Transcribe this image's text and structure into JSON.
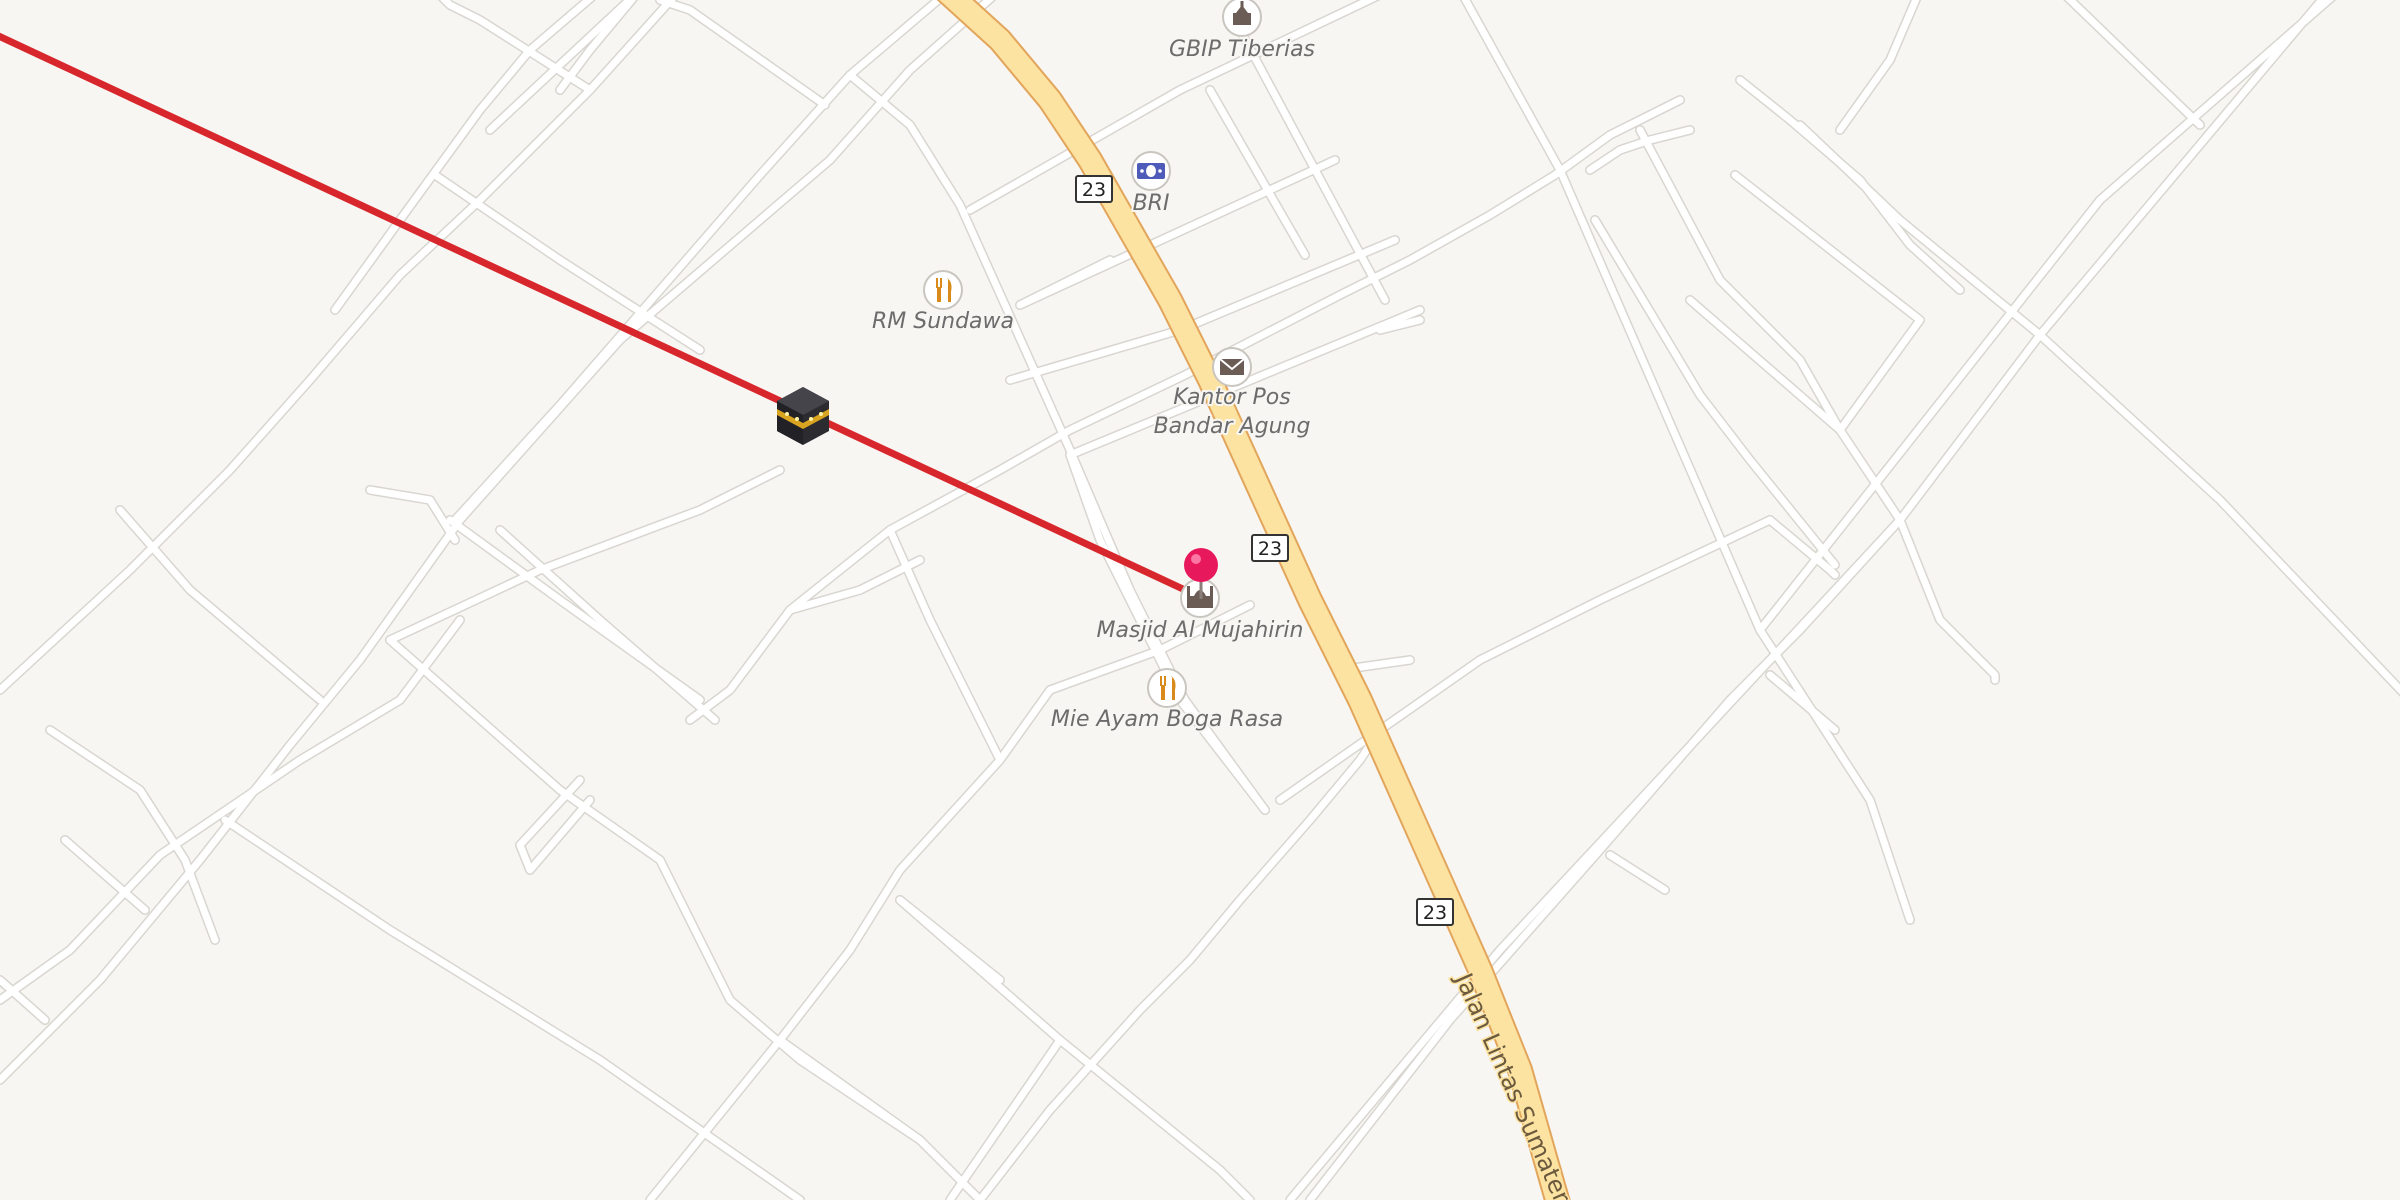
{
  "map": {
    "highway": {
      "route_number": "23",
      "street_name": "Jalan Lintas Sumatera"
    },
    "pois": [
      {
        "name": "GBIP Tiberias",
        "icon": "church-icon"
      },
      {
        "name": "BRI",
        "icon": "bank-icon"
      },
      {
        "name": "RM Sundawa",
        "icon": "restaurant-icon"
      },
      {
        "name": "Kantor Pos",
        "name_line2": "Bandar Agung",
        "icon": "post-office-icon"
      },
      {
        "name": "Masjid Al Mujahirin",
        "icon": "mosque-icon"
      },
      {
        "name": "Mie Ayam Boga Rasa",
        "icon": "restaurant-icon"
      }
    ],
    "markers": {
      "location_pin": {
        "icon": "location-pin-icon",
        "color": "#e8185c"
      },
      "qibla": {
        "icon": "kaaba-icon",
        "line_color": "#d8272c"
      }
    },
    "colors": {
      "background": "#f8f6f2",
      "minor_road": "#ffffff",
      "primary_road": "#fde3a1",
      "primary_road_casing": "#e2a55c"
    }
  }
}
